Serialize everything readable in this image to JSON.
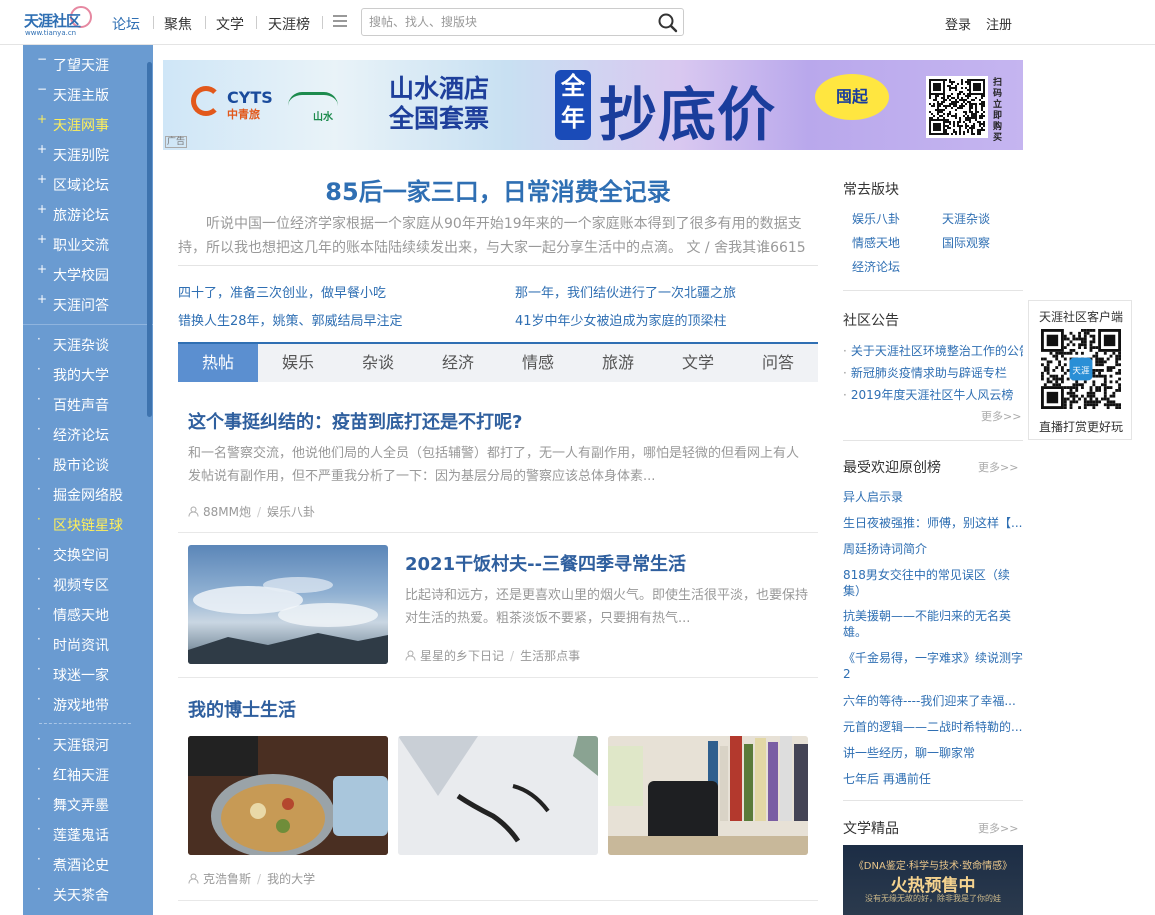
{
  "header": {
    "logo_cn": "天涯社区",
    "logo_en": "www.tianya.cn",
    "nav": [
      "论坛",
      "聚焦",
      "文学",
      "天涯榜"
    ],
    "search_placeholder": "搜帖、找人、搜版块",
    "login": "登录",
    "register": "注册"
  },
  "sidebar": {
    "groups": [
      [
        {
          "pre": "−",
          "label": "了望天涯"
        },
        {
          "pre": "−",
          "label": "天涯主版"
        },
        {
          "pre": "+",
          "label": "天涯网事",
          "highlight": true
        },
        {
          "pre": "+",
          "label": "天涯别院"
        },
        {
          "pre": "+",
          "label": "区域论坛"
        },
        {
          "pre": "+",
          "label": "旅游论坛"
        },
        {
          "pre": "+",
          "label": "职业交流"
        },
        {
          "pre": "+",
          "label": "大学校园"
        },
        {
          "pre": "+",
          "label": "天涯问答"
        }
      ],
      [
        {
          "pre": "·",
          "label": "天涯杂谈"
        },
        {
          "pre": "·",
          "label": "我的大学"
        },
        {
          "pre": "·",
          "label": "百姓声音"
        },
        {
          "pre": "·",
          "label": "经济论坛"
        },
        {
          "pre": "·",
          "label": "股市论谈"
        },
        {
          "pre": "·",
          "label": "掘金网络股"
        },
        {
          "pre": "·",
          "label": "区块链星球",
          "highlight": true
        },
        {
          "pre": "·",
          "label": "交换空间"
        },
        {
          "pre": "·",
          "label": "视频专区"
        },
        {
          "pre": "·",
          "label": "情感天地"
        },
        {
          "pre": "·",
          "label": "时尚资讯"
        },
        {
          "pre": "·",
          "label": "球迷一家"
        },
        {
          "pre": "·",
          "label": "游戏地带"
        }
      ],
      [
        {
          "pre": "·",
          "label": "天涯银河"
        },
        {
          "pre": "·",
          "label": "红袖天涯"
        },
        {
          "pre": "·",
          "label": "舞文弄墨"
        },
        {
          "pre": "·",
          "label": "莲蓬鬼话"
        },
        {
          "pre": "·",
          "label": "煮酒论史"
        },
        {
          "pre": "·",
          "label": "关天茶舍"
        }
      ]
    ]
  },
  "ad": {
    "brand1": "CYTS",
    "brand1_cn": "中青旅",
    "brand2": "山水",
    "hotel_text": "山水酒店 全国套票",
    "year_text": "全年",
    "big_text": "抄底价",
    "tag": "囤起",
    "qr_text": "扫码立即购买",
    "mark": "广告"
  },
  "feature": {
    "title": "85后一家三口，日常消费全记录",
    "desc": "听说中国一位经济学家根据一个家庭从90年开始19年来的一个家庭账本得到了很多有用的数据支持，所以我也想把这几年的账本陆陆续续发出来，与大家一起分享生活中的点滴。 文 / 舍我其谁6615",
    "links": [
      "四十了，准备三次创业，做早餐小吃",
      "那一年，我们结伙进行了一次北疆之旅",
      "错换人生28年，姚策、郭威结局早注定",
      "41岁中年少女被迫成为家庭的顶梁柱"
    ]
  },
  "tabs": [
    "热帖",
    "娱乐",
    "杂谈",
    "经济",
    "情感",
    "旅游",
    "文学",
    "问答"
  ],
  "posts": [
    {
      "title": "这个事挺纠结的：疫苗到底打还是不打呢?",
      "body": "和一名警察交流，他说他们局的人全员（包括辅警）都打了，无一人有副作用，哪怕是轻微的但看网上有人发帖说有副作用，但不严重我分析了一下：因为基层分局的警察应该总体身体素...",
      "author": "88MM炮",
      "board": "娱乐八卦"
    },
    {
      "title": "2021干饭村夫--三餐四季寻常生活",
      "body": "比起诗和远方，还是更喜欢山里的烟火气。即使生活很平淡，也要保持对生活的热爱。粗茶淡饭不要紧，只要拥有热气...",
      "author": "星星的乡下日记",
      "board": "生活那点事"
    },
    {
      "title": "我的博士生活",
      "author": "克浩鲁斯",
      "board": "我的大学"
    }
  ],
  "right": {
    "frequent_title": "常去版块",
    "frequent": [
      "娱乐八卦",
      "天涯杂谈",
      "情感天地",
      "国际观察",
      "经济论坛"
    ],
    "notice_title": "社区公告",
    "notices": [
      "关于天涯社区环境整治工作的公告",
      "新冠肺炎疫情求助与辟谣专栏",
      "2019年度天涯社区牛人风云榜"
    ],
    "more": "更多>>",
    "rank_title": "最受欢迎原创榜",
    "rank": [
      "异人启示录",
      "生日夜被强推：师傅，别这样【...",
      "周廷扬诗词简介",
      "818男女交往中的常见误区（续集）",
      "抗美援朝——不能归来的无名英雄。",
      "《千金易得，一字难求》续说测字2",
      "六年的等待----我们迎来了幸福...",
      "元首的逻辑——二战时希特勒的...",
      "讲一些经历，聊一聊家常",
      "七年后 再遇前任"
    ],
    "lit_title": "文学精品",
    "lit_img_t1": "《DNA鉴定·科学与技术·致命情感》",
    "lit_img_t2": "火热预售中",
    "lit_img_t3": "没有无缘无故的好，除非我是了你的娃"
  },
  "client": {
    "title": "天涯社区客户端",
    "caption": "直播打赏更好玩",
    "qr_logo": "天涯"
  },
  "colors": {
    "brand_blue": "#2f6fb3",
    "sidebar_bg": "#6a9bd1",
    "highlight": "#ffef5a"
  }
}
